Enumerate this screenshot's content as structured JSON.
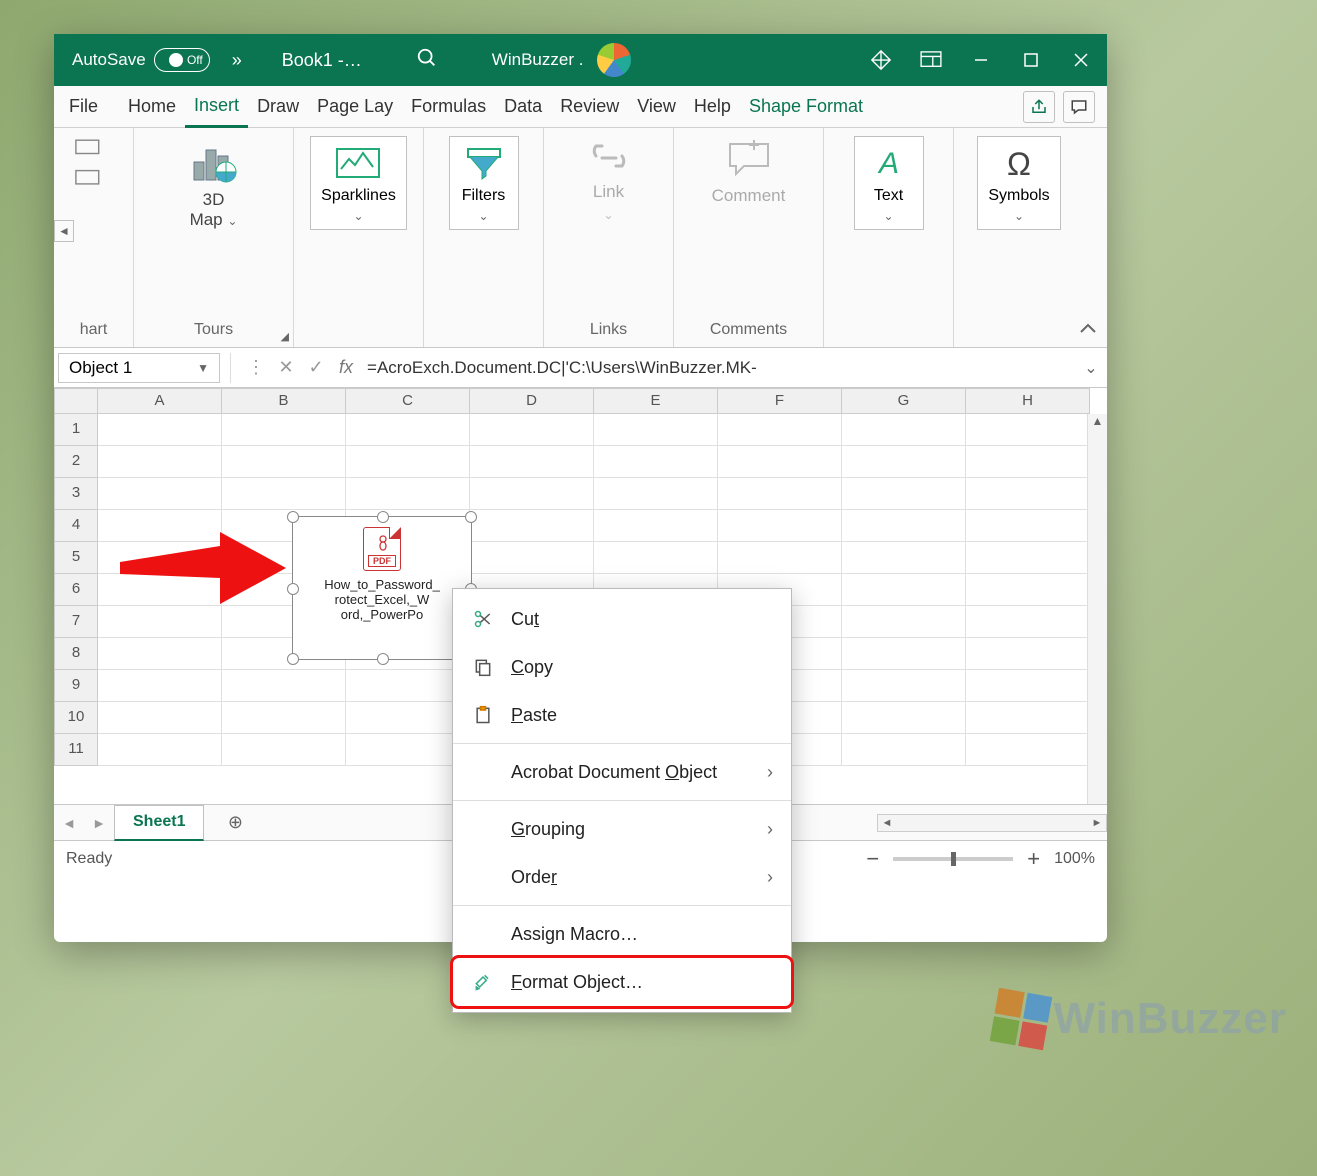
{
  "titlebar": {
    "autosave_label": "AutoSave",
    "autosave_state": "Off",
    "overflow": "»",
    "doc_title": "Book1  -…",
    "user_name": "WinBuzzer ."
  },
  "tabs": {
    "file": "File",
    "home": "Home",
    "insert": "Insert",
    "draw": "Draw",
    "page_layout": "Page Lay",
    "formulas": "Formulas",
    "data": "Data",
    "review": "Review",
    "view": "View",
    "help": "Help",
    "shape_format": "Shape Format"
  },
  "ribbon": {
    "hart_group": "hart",
    "tours_label": "Tours",
    "map_btn": "3D\nMap",
    "sparklines": "Sparklines",
    "filters": "Filters",
    "link": "Link",
    "links_label": "Links",
    "comment": "Comment",
    "comments_label": "Comments",
    "text": "Text",
    "symbols": "Symbols"
  },
  "namebox": {
    "value": "Object 1"
  },
  "formula_bar": {
    "fx": "fx",
    "value": "=AcroExch.Document.DC|'C:\\Users\\WinBuzzer.MK-"
  },
  "columns": [
    "A",
    "B",
    "C",
    "D",
    "E",
    "F",
    "G",
    "H"
  ],
  "rows": [
    "1",
    "2",
    "3",
    "4",
    "5",
    "6",
    "7",
    "8",
    "9",
    "10",
    "11"
  ],
  "pdf_object": {
    "icon_tag": "PDF",
    "name_line1": "How_to_Password_",
    "name_line2": "rotect_Excel,_W",
    "name_line3": "ord,_PowerPo"
  },
  "sheet_tabs": {
    "sheet1": "Sheet1"
  },
  "statusbar": {
    "ready": "Ready",
    "zoom": "100%"
  },
  "context_menu": {
    "cut": "Cut",
    "copy": "Copy",
    "paste": "Paste",
    "acrobat": "Acrobat Document Object",
    "grouping": "Grouping",
    "order": "Order",
    "assign_macro": "Assign Macro…",
    "format_object": "Format Object…"
  },
  "watermark": "WinBuzzer"
}
